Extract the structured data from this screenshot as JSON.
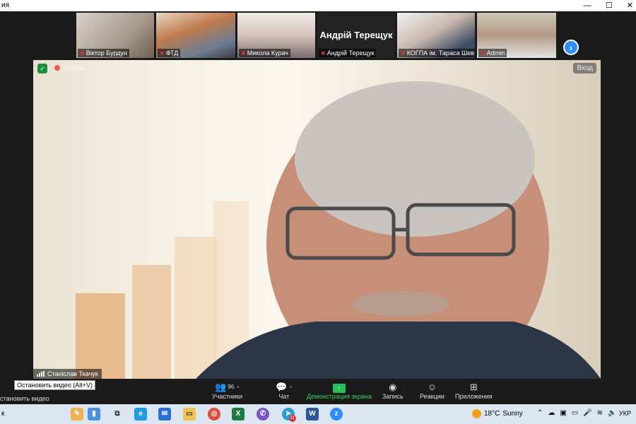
{
  "window": {
    "title": "ия"
  },
  "gallery": {
    "participants": [
      {
        "name": "Віктор Бурдун",
        "muted": true
      },
      {
        "name": "ФТД",
        "muted": true
      },
      {
        "name": "Микола Курач",
        "muted": true
      },
      {
        "name": "Андрій Терещук",
        "muted": true,
        "display_name": "Андрій Терещук"
      },
      {
        "name": "КОГПА ім. Тараса Шев...",
        "muted": true
      },
      {
        "name": "Admin",
        "muted": true
      }
    ],
    "next_icon": "chevron-right-icon"
  },
  "main": {
    "recording_label": "Запись",
    "enter_label": "Вход",
    "speaker_name": "Станіслав Ткачук"
  },
  "toolbar": {
    "tooltip": "Остановить видео (Alt+V)",
    "stop_video_label": "становить видео",
    "participants_label": "Участники",
    "participants_count": "96",
    "chat_label": "Чат",
    "share_label": "Демонстрация экрана",
    "record_label": "Запись",
    "reactions_label": "Реакции",
    "apps_label": "Приложения"
  },
  "taskbar": {
    "left_char": "к",
    "weather_temp": "18°C",
    "weather_text": "Sunny",
    "lang": "УКР",
    "telegram_badge": "21"
  },
  "colors": {
    "accent": "#2d8cff",
    "share_green": "#25c05a",
    "muted_red": "#e0303c"
  }
}
